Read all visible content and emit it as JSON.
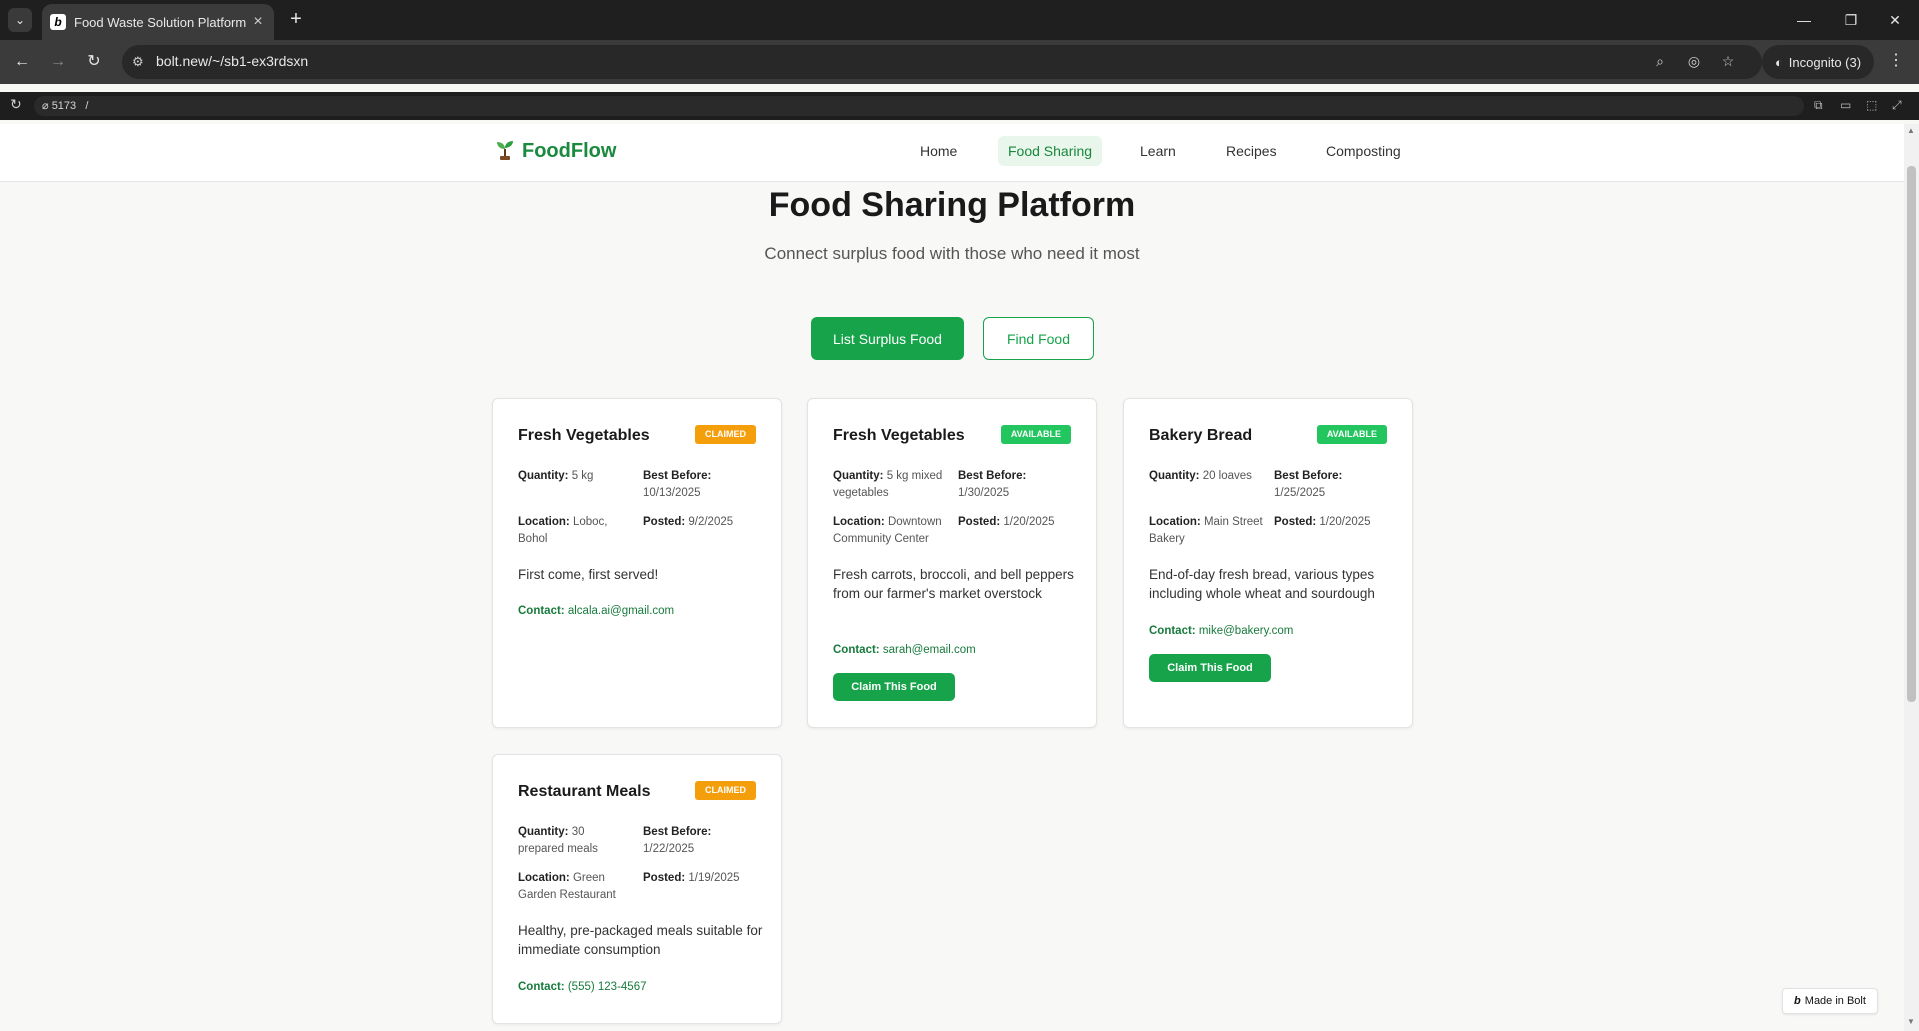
{
  "browser": {
    "tab_title": "Food Waste Solution Platform",
    "url": "bolt.new/~/sb1-ex3rdsxn",
    "incognito_label": "Incognito (3)",
    "dev_port": "5173",
    "dev_path": "/"
  },
  "app": {
    "logo": "FoodFlow",
    "nav": [
      "Home",
      "Food Sharing",
      "Learn",
      "Recipes",
      "Composting"
    ],
    "active_nav": "Food Sharing",
    "heading": "Food Sharing Platform",
    "subheading": "Connect surplus food with those who need it most",
    "buttons": {
      "list": "List Surplus Food",
      "find": "Find Food"
    },
    "labels": {
      "quantity": "Quantity:",
      "best_before": "Best Before:",
      "location": "Location:",
      "posted": "Posted:",
      "contact": "Contact:",
      "claim": "Claim This Food"
    },
    "cards": [
      {
        "title": "Fresh Vegetables",
        "status": "CLAIMED",
        "quantity": "5 kg",
        "best_before": "10/13/2025",
        "location": "Loboc, Bohol",
        "posted": "9/2/2025",
        "description": "First come, first served!",
        "contact": "alcala.ai@gmail.com"
      },
      {
        "title": "Fresh Vegetables",
        "status": "AVAILABLE",
        "quantity": "5 kg mixed vegetables",
        "best_before": "1/30/2025",
        "location": "Downtown Community Center",
        "posted": "1/20/2025",
        "description": "Fresh carrots, broccoli, and bell peppers from our farmer's market overstock",
        "contact": "sarah@email.com"
      },
      {
        "title": "Bakery Bread",
        "status": "AVAILABLE",
        "quantity": "20 loaves",
        "best_before": "1/25/2025",
        "location": "Main Street Bakery",
        "posted": "1/20/2025",
        "description": "End-of-day fresh bread, various types including whole wheat and sourdough",
        "contact": "mike@bakery.com"
      },
      {
        "title": "Restaurant Meals",
        "status": "CLAIMED",
        "quantity": "30 prepared meals",
        "best_before": "1/22/2025",
        "location": "Green Garden Restaurant",
        "posted": "1/19/2025",
        "description": "Healthy, pre-packaged meals suitable for immediate consumption",
        "contact": "(555) 123-4567"
      }
    ],
    "made_in": "Made in Bolt"
  },
  "colors": {
    "primary": "#16a34a",
    "claimed": "#f59e0b",
    "available": "#22c55e"
  }
}
